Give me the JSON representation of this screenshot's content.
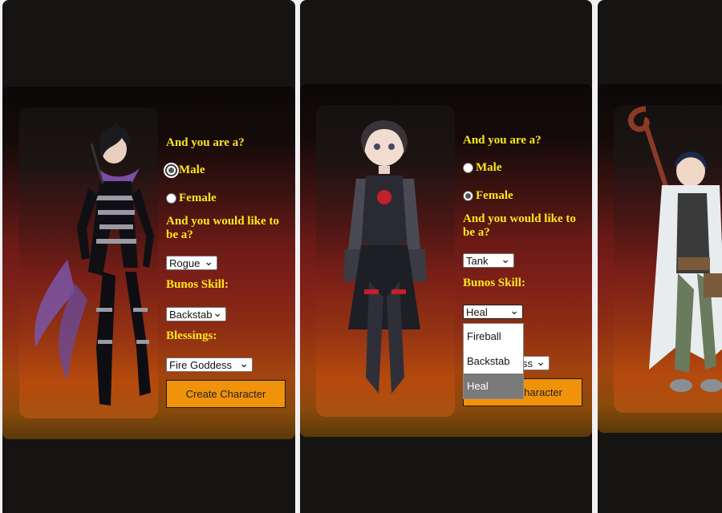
{
  "cards": [
    {
      "gender_question": "And you are a?",
      "genders": [
        "Male",
        "Female"
      ],
      "gender_selected": "Male",
      "class_question": "And you would like to be a?",
      "class_value": "Rogue",
      "skill_label": "Bunos Skill:",
      "skill_value": "Backstab",
      "blessing_label": "Blessings:",
      "blessing_value": "Fire Goddess",
      "button_label": "Create Character"
    },
    {
      "gender_question": "And you are a?",
      "genders": [
        "Male",
        "Female"
      ],
      "gender_selected": "Female",
      "class_question": "And you would like to be a?",
      "class_value": "Tank",
      "skill_label": "Bunos Skill:",
      "skill_value": "Heal",
      "skill_options": [
        "Fireball",
        "Backstab",
        "Heal"
      ],
      "skill_highlighted": "Heal",
      "blessing_value_visible": "ss",
      "button_label_visible": "haracter"
    }
  ],
  "colors": {
    "label_yellow": "#ffe81a",
    "button_orange": "#f0920a",
    "panel_bg": "#161412"
  }
}
